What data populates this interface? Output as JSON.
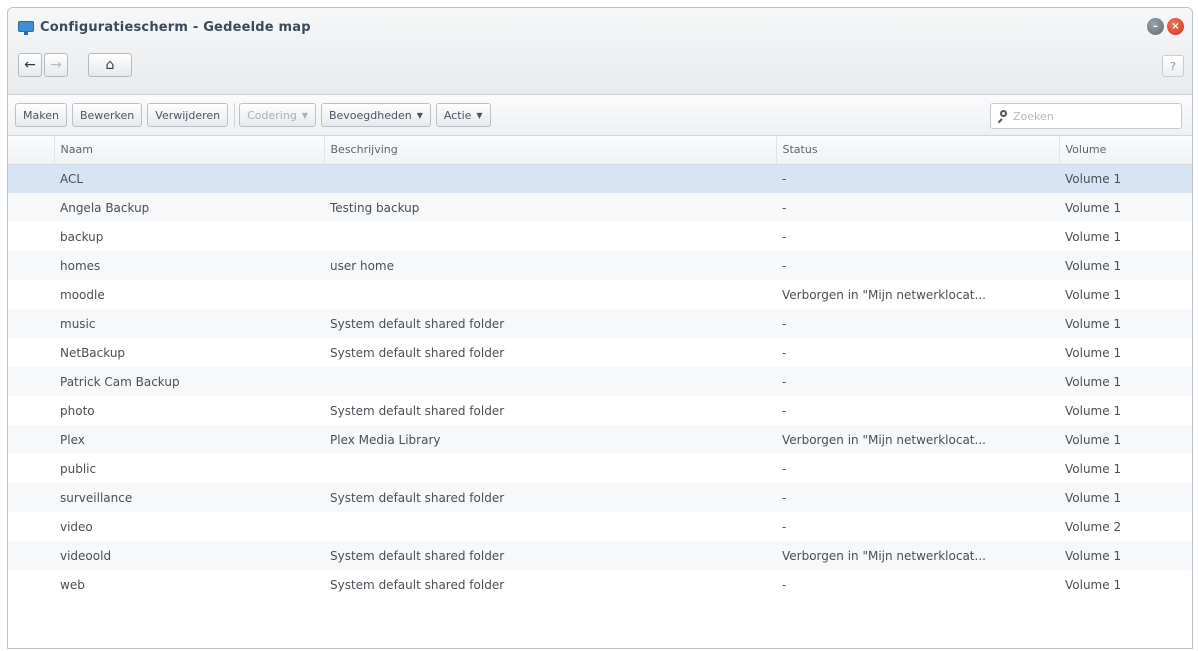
{
  "window": {
    "title": "Configuratiescherm - Gedeelde map",
    "help_label": "?"
  },
  "nav": {
    "back_icon": "arrow-left-icon",
    "forward_icon": "arrow-right-icon",
    "home_icon": "home-icon"
  },
  "toolbar": {
    "create": "Maken",
    "edit": "Bewerken",
    "delete": "Verwijderen",
    "encryption": "Codering",
    "permissions": "Bevoegdheden",
    "action": "Actie",
    "search_placeholder": "Zoeken"
  },
  "table": {
    "headers": [
      "Naam",
      "Beschrijving",
      "Status",
      "Volume"
    ],
    "rows": [
      {
        "name": "ACL",
        "description": "",
        "status": "-",
        "volume": "Volume 1",
        "selected": true
      },
      {
        "name": "Angela Backup",
        "description": "Testing backup",
        "status": "-",
        "volume": "Volume 1"
      },
      {
        "name": "backup",
        "description": "",
        "status": "-",
        "volume": "Volume 1"
      },
      {
        "name": "homes",
        "description": "user home",
        "status": "-",
        "volume": "Volume 1"
      },
      {
        "name": "moodle",
        "description": "",
        "status": "Verborgen in \"Mijn netwerklocat...",
        "volume": "Volume 1"
      },
      {
        "name": "music",
        "description": "System default shared folder",
        "status": "-",
        "volume": "Volume 1"
      },
      {
        "name": "NetBackup",
        "description": "System default shared folder",
        "status": "-",
        "volume": "Volume 1"
      },
      {
        "name": "Patrick Cam Backup",
        "description": "",
        "status": "-",
        "volume": "Volume 1"
      },
      {
        "name": "photo",
        "description": "System default shared folder",
        "status": "-",
        "volume": "Volume 1"
      },
      {
        "name": "Plex",
        "description": "Plex Media Library",
        "status": "Verborgen in \"Mijn netwerklocat...",
        "volume": "Volume 1"
      },
      {
        "name": "public",
        "description": "",
        "status": "-",
        "volume": "Volume 1"
      },
      {
        "name": "surveillance",
        "description": "System default shared folder",
        "status": "-",
        "volume": "Volume 1"
      },
      {
        "name": "video",
        "description": "",
        "status": "-",
        "volume": "Volume 2"
      },
      {
        "name": "videoold",
        "description": "System default shared folder",
        "status": "Verborgen in \"Mijn netwerklocat...",
        "volume": "Volume 1"
      },
      {
        "name": "web",
        "description": "System default shared folder",
        "status": "-",
        "volume": "Volume 1"
      }
    ]
  },
  "colors": {
    "selected_row": "#d6e4f3",
    "close_button": "#c8351c"
  }
}
